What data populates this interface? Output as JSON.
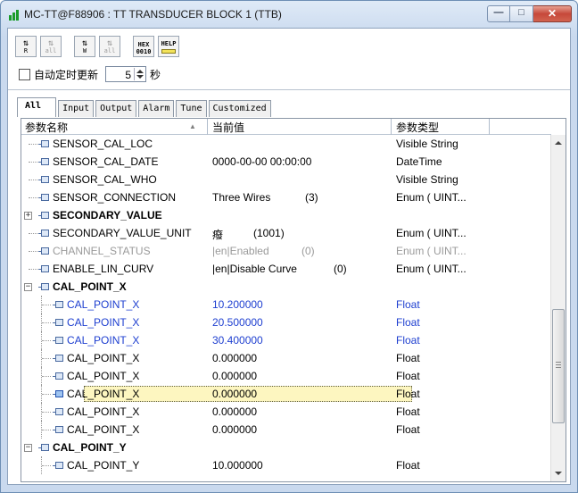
{
  "window": {
    "title": "MC-TT@F88906 : TT TRANSDUCER BLOCK 1 (TTB)",
    "minimize_glyph": "—",
    "restore_glyph": "□",
    "close_glyph": "✕"
  },
  "toolbar": {
    "buttons": [
      {
        "name": "read-button",
        "arrow": "⇅",
        "label": "R",
        "enabled": true
      },
      {
        "name": "read-all-button",
        "arrow": "⇅",
        "label": "all",
        "enabled": false
      },
      {
        "name": "write-button",
        "arrow": "⇅",
        "label": "W",
        "enabled": true
      },
      {
        "name": "write-all-button",
        "arrow": "⇅",
        "label": "all",
        "enabled": false
      },
      {
        "name": "hex-button",
        "line1": "HEX",
        "line2": "0010",
        "enabled": true
      },
      {
        "name": "help-button",
        "line1": "HELP",
        "enabled": true
      }
    ]
  },
  "auto_refresh": {
    "label": "自动定时更新",
    "checked": false,
    "interval_value": "5",
    "unit": "秒"
  },
  "tabs": [
    {
      "label": "All",
      "active": true
    },
    {
      "label": "Input",
      "active": false
    },
    {
      "label": "Output",
      "active": false
    },
    {
      "label": "Alarm",
      "active": false
    },
    {
      "label": "Tune",
      "active": false
    },
    {
      "label": "Customized",
      "active": false
    }
  ],
  "grid": {
    "headers": {
      "name": "参数名称",
      "sort_glyph": "▲",
      "value": "当前值",
      "type": "参数类型"
    },
    "rows": [
      {
        "name": "SENSOR_CAL_LOC",
        "value": "",
        "code": "",
        "type": "Visible String",
        "level": 1,
        "style": "normal"
      },
      {
        "name": "SENSOR_CAL_DATE",
        "value": "0000-00-00 00:00:00",
        "code": "",
        "type": "DateTime",
        "level": 1,
        "style": "normal"
      },
      {
        "name": "SENSOR_CAL_WHO",
        "value": "",
        "code": "",
        "type": "Visible String",
        "level": 1,
        "style": "normal"
      },
      {
        "name": "SENSOR_CONNECTION",
        "value": "Three Wires",
        "code": "(3)",
        "type": "Enum ( UINT...",
        "level": 1,
        "style": "normal"
      },
      {
        "name": "SECONDARY_VALUE",
        "value": "",
        "code": "",
        "type": "",
        "level": 1,
        "style": "bold",
        "expander": "+"
      },
      {
        "name": "SECONDARY_VALUE_UNIT",
        "value": "癈",
        "code": "(1001)",
        "type": "Enum ( UINT...",
        "level": 1,
        "style": "normal"
      },
      {
        "name": "CHANNEL_STATUS",
        "value": "|en|Enabled",
        "code": "(0)",
        "type": "Enum ( UINT...",
        "level": 1,
        "style": "gray"
      },
      {
        "name": "ENABLE_LIN_CURV",
        "value": "|en|Disable Curve",
        "code": "(0)",
        "type": "Enum ( UINT...",
        "level": 1,
        "style": "normal"
      },
      {
        "name": "CAL_POINT_X",
        "value": "",
        "code": "",
        "type": "",
        "level": 1,
        "style": "bold",
        "expander": "−"
      },
      {
        "name": "CAL_POINT_X",
        "value": "10.200000",
        "code": "",
        "type": "Float",
        "level": 2,
        "style": "blue"
      },
      {
        "name": "CAL_POINT_X",
        "value": "20.500000",
        "code": "",
        "type": "Float",
        "level": 2,
        "style": "blue"
      },
      {
        "name": "CAL_POINT_X",
        "value": "30.400000",
        "code": "",
        "type": "Float",
        "level": 2,
        "style": "blue"
      },
      {
        "name": "CAL_POINT_X",
        "value": "0.000000",
        "code": "",
        "type": "Float",
        "level": 2,
        "style": "normal"
      },
      {
        "name": "CAL_POINT_X",
        "value": "0.000000",
        "code": "",
        "type": "Float",
        "level": 2,
        "style": "normal"
      },
      {
        "name": "CAL_POINT_X",
        "value": "0.000000",
        "code": "",
        "type": "Float",
        "level": 2,
        "style": "selected"
      },
      {
        "name": "CAL_POINT_X",
        "value": "0.000000",
        "code": "",
        "type": "Float",
        "level": 2,
        "style": "normal"
      },
      {
        "name": "CAL_POINT_X",
        "value": "0.000000",
        "code": "",
        "type": "Float",
        "level": 2,
        "style": "normal"
      },
      {
        "name": "CAL_POINT_Y",
        "value": "",
        "code": "",
        "type": "",
        "level": 1,
        "style": "bold",
        "expander": "−"
      },
      {
        "name": "CAL_POINT_Y",
        "value": "10.000000",
        "code": "",
        "type": "Float",
        "level": 2,
        "style": "normal"
      }
    ]
  }
}
